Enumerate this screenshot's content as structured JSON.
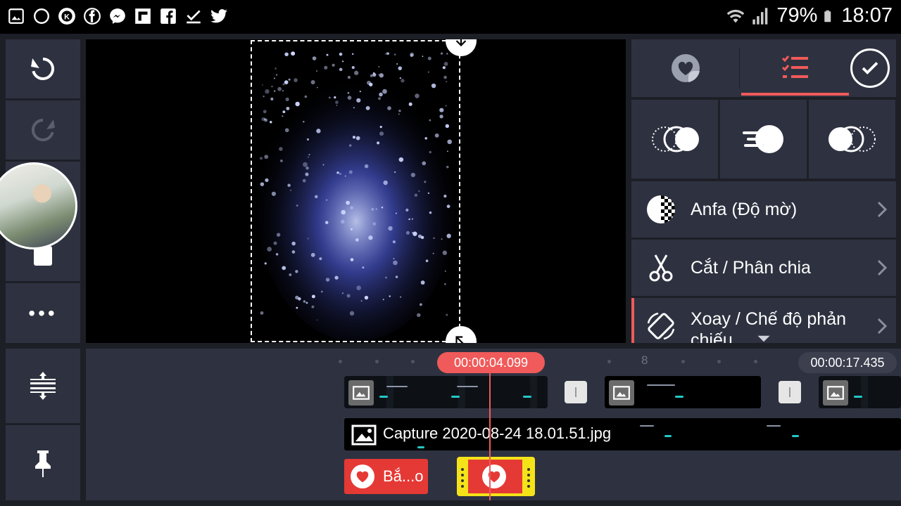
{
  "status_bar": {
    "battery": "79%",
    "time": "18:07",
    "notification_icons": [
      "gallery-icon",
      "circle-icon",
      "kinemaster-icon",
      "facebook-icon",
      "messenger-icon",
      "flipboard-icon",
      "facebook-square-icon",
      "download-done-icon",
      "twitter-icon"
    ]
  },
  "left_toolbar": {
    "undo": "undo-icon",
    "redo": "redo-icon",
    "more": "•••",
    "adjust": "timeline-expand-icon",
    "pin": "pin-icon"
  },
  "right_panel": {
    "tabs": [
      "sticker-tab",
      "options-tab"
    ],
    "transitions": [
      "fade-in-transition",
      "motion-transition",
      "fade-out-transition"
    ],
    "menu": [
      {
        "label": "Anfa (Độ mờ)",
        "icon": "alpha-icon"
      },
      {
        "label": "Cắt / Phân chia",
        "icon": "scissors-icon"
      },
      {
        "label": "Xoay / Chế độ phản chiếu",
        "icon": "rotate-icon"
      }
    ]
  },
  "timeline": {
    "current_time": "00:00:04.099",
    "end_time": "00:00:17.435",
    "tick_label": "8",
    "image_layer_label": "Capture 2020-08-24 18.01.51.jpg",
    "sticker_label": "Bắ...o"
  },
  "colors": {
    "accent": "#f05a5a",
    "panel": "#2e3240",
    "background": "#1d1f27",
    "sticker_selected": "#f5e31a",
    "sticker": "#e53935"
  }
}
